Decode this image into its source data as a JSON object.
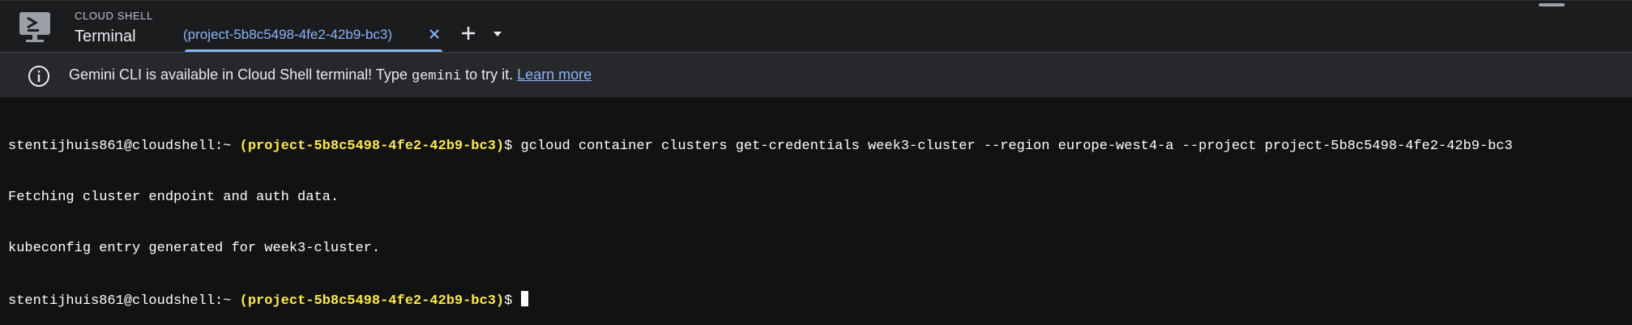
{
  "header": {
    "product_label": "CLOUD SHELL",
    "page_title": "Terminal",
    "active_tab": {
      "label": "(project-5b8c5498-4fe2-42b9-bc3)"
    },
    "icons": {
      "logo": "cloud-shell-icon",
      "close": "close-icon",
      "add": "plus-icon",
      "menu": "chevron-down-icon",
      "minimize": "minimize-icon"
    }
  },
  "banner": {
    "icon": "info-icon",
    "text_before": "Gemini CLI is available in Cloud Shell terminal! Type ",
    "command": "gemini",
    "text_after": " to try it. ",
    "link_label": "Learn more"
  },
  "terminal": {
    "prompt_user": "stentijhuis861@cloudshell:~ ",
    "prompt_project": "(project-5b8c5498-4fe2-42b9-bc3)",
    "prompt_symbol": "$ ",
    "command": "gcloud container clusters get-credentials week3-cluster --region europe-west4-a --project project-5b8c5498-4fe2-42b9-bc3",
    "output": [
      "Fetching cluster endpoint and auth data.",
      "kubeconfig entry generated for week3-cluster."
    ]
  },
  "colors": {
    "accent": "#8ab4f8",
    "prompt_project": "#fce94f",
    "terminal_bg": "#121212",
    "header_bg": "#1b1c1e",
    "banner_bg": "#27282b"
  }
}
